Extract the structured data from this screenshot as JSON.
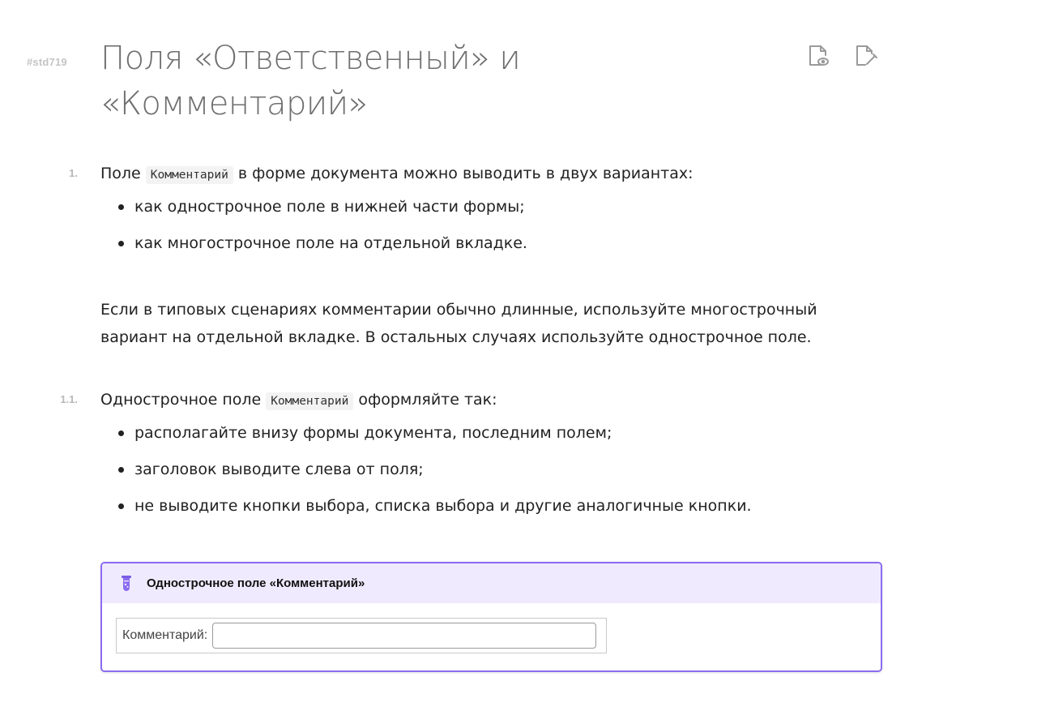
{
  "header": {
    "std_id": "#std719",
    "title_line1": "Поля «Ответственный» и",
    "title_line2": "«Комментарий»",
    "icons": [
      "document-preview-icon",
      "document-edit-icon"
    ]
  },
  "section1": {
    "number": "1.",
    "text_before": "Поле",
    "code": "Комментарий",
    "text_after": "в форме документа можно выводить в двух вариантах:",
    "bullets": [
      "как однострочное поле в нижней части формы;",
      "как многострочное поле на отдельной вкладке."
    ],
    "paragraph": "Если в типовых сценариях комментарии обычно длинные, используйте многострочный вариант на отдельной вкладке. В остальных случаях используйте однострочное поле."
  },
  "section11": {
    "number": "1.1.",
    "text_before": "Однострочное поле",
    "code": "Комментарий",
    "text_after": "оформляйте так:",
    "bullets": [
      "располагайте внизу формы документа, последним полем;",
      "заголовок выводите слева от поля;",
      "не выводите кнопки выбора, списка выбора и другие аналогичные кнопки."
    ]
  },
  "example": {
    "title": "Однострочное поле «Комментарий»",
    "field_label": "Комментарий:",
    "field_value": "",
    "icon": "flask-icon",
    "accent_color": "#8b6cf0",
    "header_bg": "#efeafe"
  }
}
